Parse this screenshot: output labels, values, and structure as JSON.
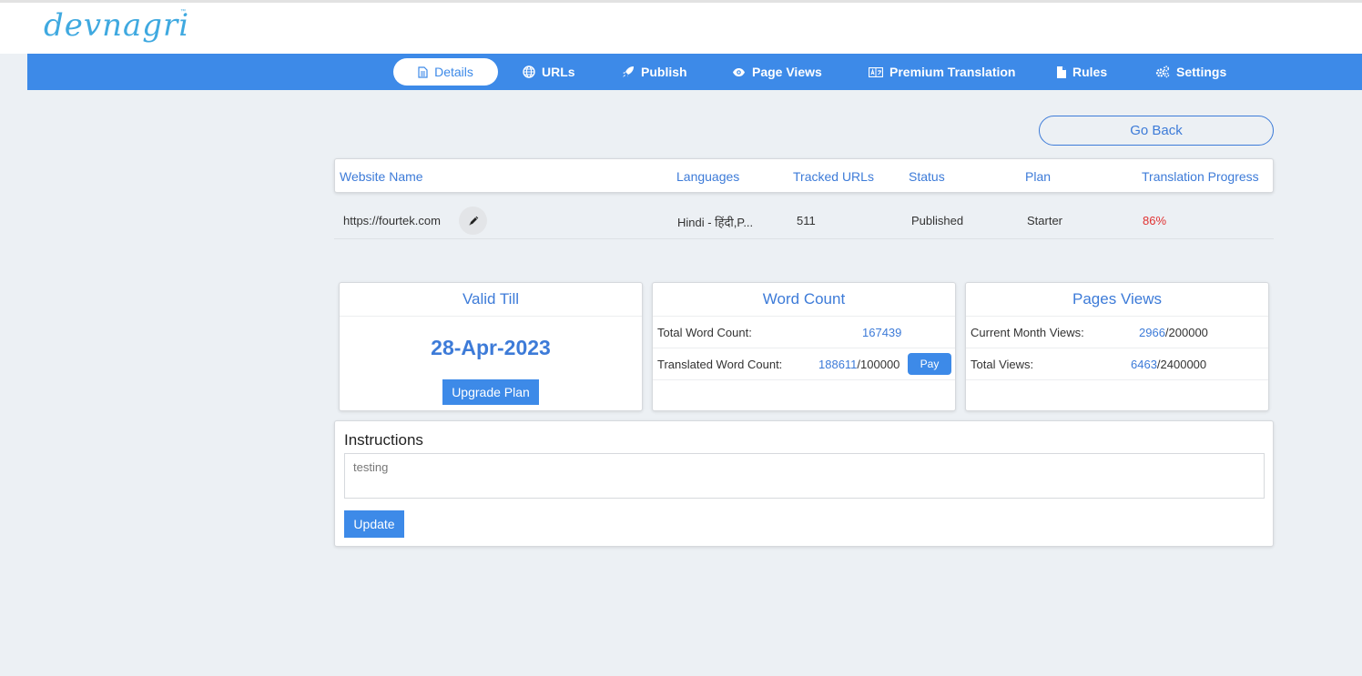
{
  "app": {
    "logo_text": "devnagri",
    "logo_tm": "™"
  },
  "nav": {
    "tabs": [
      {
        "label": "Details",
        "icon": "document-icon",
        "active": true
      },
      {
        "label": "URLs",
        "icon": "globe-icon",
        "active": false
      },
      {
        "label": "Publish",
        "icon": "rocket-icon",
        "active": false
      },
      {
        "label": "Page Views",
        "icon": "eye-icon",
        "active": false
      },
      {
        "label": "Premium Translation",
        "icon": "translate-icon",
        "active": false
      },
      {
        "label": "Rules",
        "icon": "file-icon",
        "active": false
      },
      {
        "label": "Settings",
        "icon": "gears-icon",
        "active": false
      }
    ],
    "bar_color": "#3d8ae8"
  },
  "go_back_label": "Go Back",
  "table": {
    "headers": [
      "Website Name",
      "Languages",
      "Tracked URLs",
      "Status",
      "Plan",
      "Translation Progress"
    ],
    "row": {
      "website": "https://fourtek.com",
      "languages": "Hindi - हिंदी,P...",
      "tracked_urls": "511",
      "status": "Published",
      "plan": "Starter",
      "progress": "86%"
    },
    "progress_color": "#e03131"
  },
  "valid_till": {
    "title": "Valid Till",
    "date": "28-Apr-2023",
    "upgrade_label": "Upgrade Plan"
  },
  "word_count": {
    "title": "Word Count",
    "total_label": "Total Word Count:",
    "total_value": "167439",
    "translated_label": "Translated Word Count:",
    "translated_value": "188611",
    "translated_limit": "/100000",
    "pay_label": "Pay"
  },
  "page_views": {
    "title": "Pages Views",
    "month_label": "Current Month Views:",
    "month_value": "2966",
    "month_limit": "/200000",
    "total_label": "Total Views:",
    "total_value": "6463",
    "total_limit": "/2400000"
  },
  "instructions": {
    "title": "Instructions",
    "value": "testing",
    "update_label": "Update"
  }
}
